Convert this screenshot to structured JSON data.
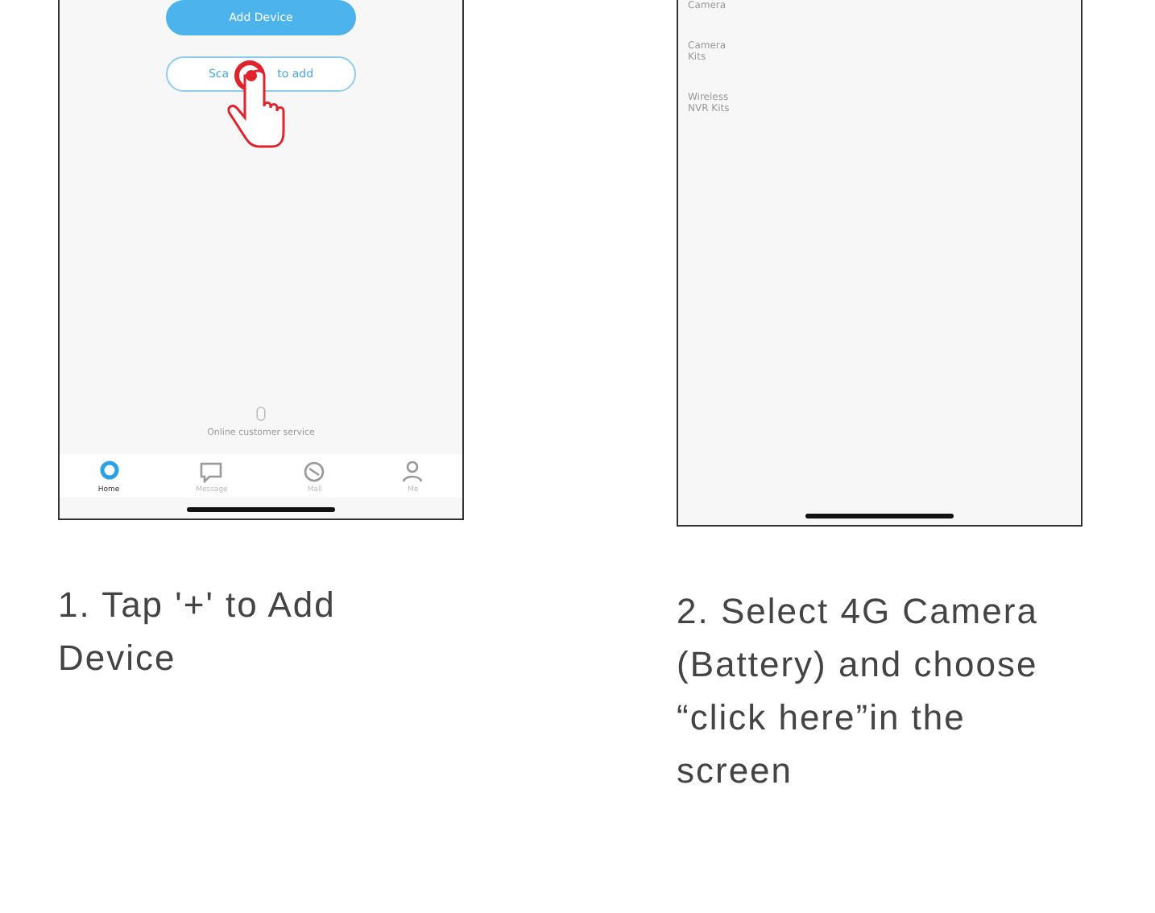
{
  "steps": [
    {
      "kind": "home",
      "caption": "1. Tap '+' to Add Device",
      "add_button": "Add Device",
      "scan_button": {
        "label_start": "Sca",
        "label_end": "to add"
      },
      "service": "Online customer service",
      "tabs": [
        {
          "label": "Home",
          "kind": "home",
          "selected": true
        },
        {
          "label": "Message",
          "kind": "message",
          "selected": false
        },
        {
          "label": "Mall",
          "kind": "mall",
          "selected": false
        },
        {
          "label": "Me",
          "kind": "me",
          "selected": false
        }
      ]
    },
    {
      "kind": "list",
      "caption": "2. Select 4G Camera (Battery) and choose “click here”in the screen",
      "categories": [
        "Camera",
        "Camera Kits",
        "Wireless NVR Kits"
      ]
    }
  ]
}
